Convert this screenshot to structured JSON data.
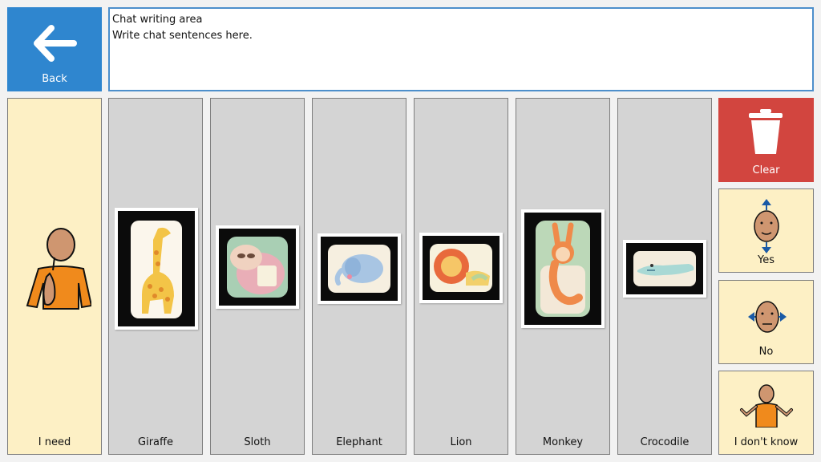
{
  "back": {
    "label": "Back",
    "icon": "arrow-left-icon"
  },
  "chat": {
    "title": "Chat writing area",
    "placeholder": "Write chat sentences here."
  },
  "tiles": [
    {
      "label": "I need",
      "icon": "person-pointing-self-icon"
    },
    {
      "label": "Giraffe"
    },
    {
      "label": "Sloth"
    },
    {
      "label": "Elephant"
    },
    {
      "label": "Lion"
    },
    {
      "label": "Monkey"
    },
    {
      "label": "Crocodile"
    }
  ],
  "side": {
    "clear": {
      "label": "Clear",
      "icon": "trash-can-icon"
    },
    "yes": {
      "label": "Yes",
      "icon": "head-nod-icon"
    },
    "no": {
      "label": "No",
      "icon": "head-shake-icon"
    },
    "dont_know": {
      "label": "I don't know",
      "icon": "shrug-icon"
    }
  },
  "colors": {
    "back": "#2f86cf",
    "clear": "#d2453f",
    "yellow_tile": "#fdf0c5",
    "gray_tile": "#d4d4d4"
  }
}
